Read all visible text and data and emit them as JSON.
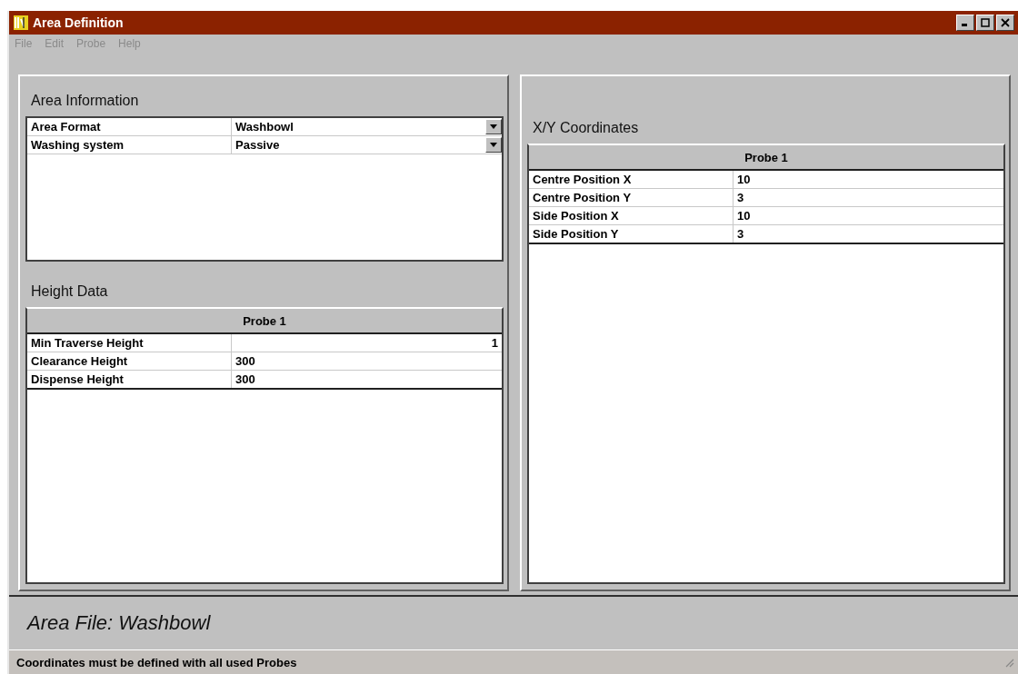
{
  "window": {
    "title": "Area Definition"
  },
  "menu": [
    {
      "label": "File",
      "disabled": true
    },
    {
      "label": "Edit",
      "disabled": true
    },
    {
      "label": "Probe",
      "disabled": true
    },
    {
      "label": "Help",
      "disabled": true
    }
  ],
  "area_information": {
    "title": "Area Information",
    "rows": [
      {
        "label": "Area Format",
        "value": "Washbowl"
      },
      {
        "label": "Washing system",
        "value": "Passive"
      }
    ]
  },
  "height_data": {
    "title": "Height Data",
    "column": "Probe 1",
    "rows": [
      {
        "label": "Min Traverse Height",
        "value": "1",
        "kind": "right"
      },
      {
        "label": "Clearance Height",
        "value": "300",
        "kind": "left"
      },
      {
        "label": "Dispense Height",
        "value": "300",
        "kind": "left"
      }
    ]
  },
  "xy_coordinates": {
    "title": "X/Y Coordinates",
    "column": "Probe 1",
    "rows": [
      {
        "label": "Centre Position X",
        "value": "10",
        "kind": "left"
      },
      {
        "label": "Centre Position Y",
        "value": "3",
        "kind": "left"
      },
      {
        "label": "Side Position X",
        "value": "10",
        "kind": "left"
      },
      {
        "label": "Side Position Y",
        "value": "3",
        "kind": "left"
      }
    ]
  },
  "area_file": "Area File: Washbowl",
  "status_bar": "Coordinates must be defined with all used Probes"
}
